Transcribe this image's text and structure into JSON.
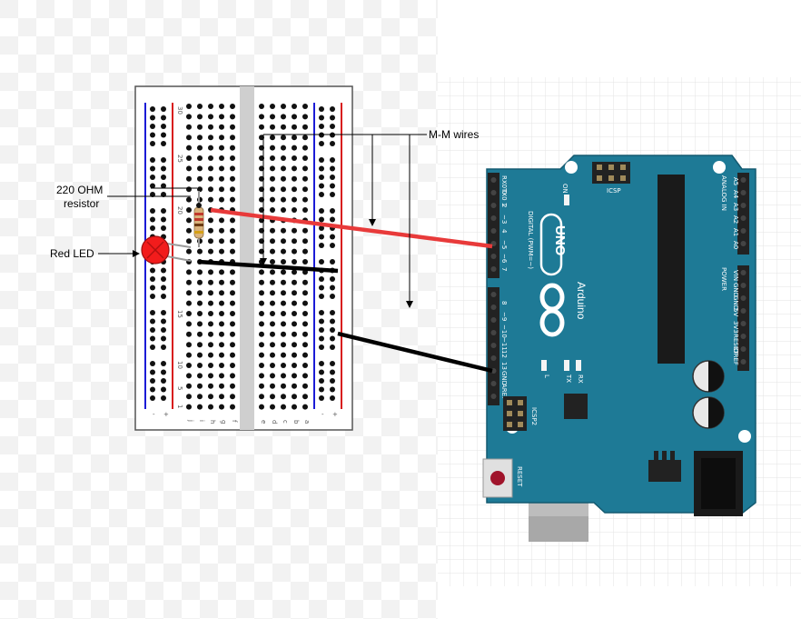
{
  "annotations": {
    "wires_label": "M-M wires",
    "resistor_label_line1": "220 OHM",
    "resistor_label_line2": "resistor",
    "led_label": "Red LED"
  },
  "breadboard": {
    "row_numbers": [
      "30",
      "25",
      "20",
      "15",
      "10",
      "5",
      "1"
    ],
    "column_letters_left": [
      "j",
      "i",
      "h",
      "g",
      "f"
    ],
    "column_letters_right": [
      "e",
      "d",
      "c",
      "b",
      "a"
    ],
    "rail_signs": [
      "-",
      "+",
      "-",
      "+"
    ]
  },
  "arduino": {
    "model": "UNO",
    "brand": "Arduino",
    "digital_label": "DIGITAL (PWM=~)",
    "analog_label": "ANALOG IN",
    "power_label": "POWER",
    "icsp_label": "ICSP",
    "icsp2_label": "ICSP2",
    "reset_label": "RESET",
    "on_label": "ON",
    "l_label": "L",
    "tx_label": "TX",
    "rx_label": "RX",
    "digital_pins_top": [
      "RX0 0",
      "TX0 1",
      "2",
      "~3",
      "4",
      "~5",
      "~6",
      "7"
    ],
    "digital_pins_bottom": [
      "8",
      "~9",
      "~10",
      "~11",
      "12",
      "13",
      "GND",
      "AREF"
    ],
    "analog_pins": [
      "A5",
      "A4",
      "A3",
      "A2",
      "A1",
      "A0"
    ],
    "power_pins": [
      "VIN",
      "GND",
      "GND",
      "5V",
      "3V3",
      "RESET",
      "IOREF"
    ]
  },
  "colors": {
    "board": "#1e7a96",
    "red_wire": "#e83a3a",
    "black_wire": "#000000",
    "rail_blue": "#1b1bd6",
    "rail_red": "#d81b1b",
    "led_fill": "#f21c1c"
  }
}
